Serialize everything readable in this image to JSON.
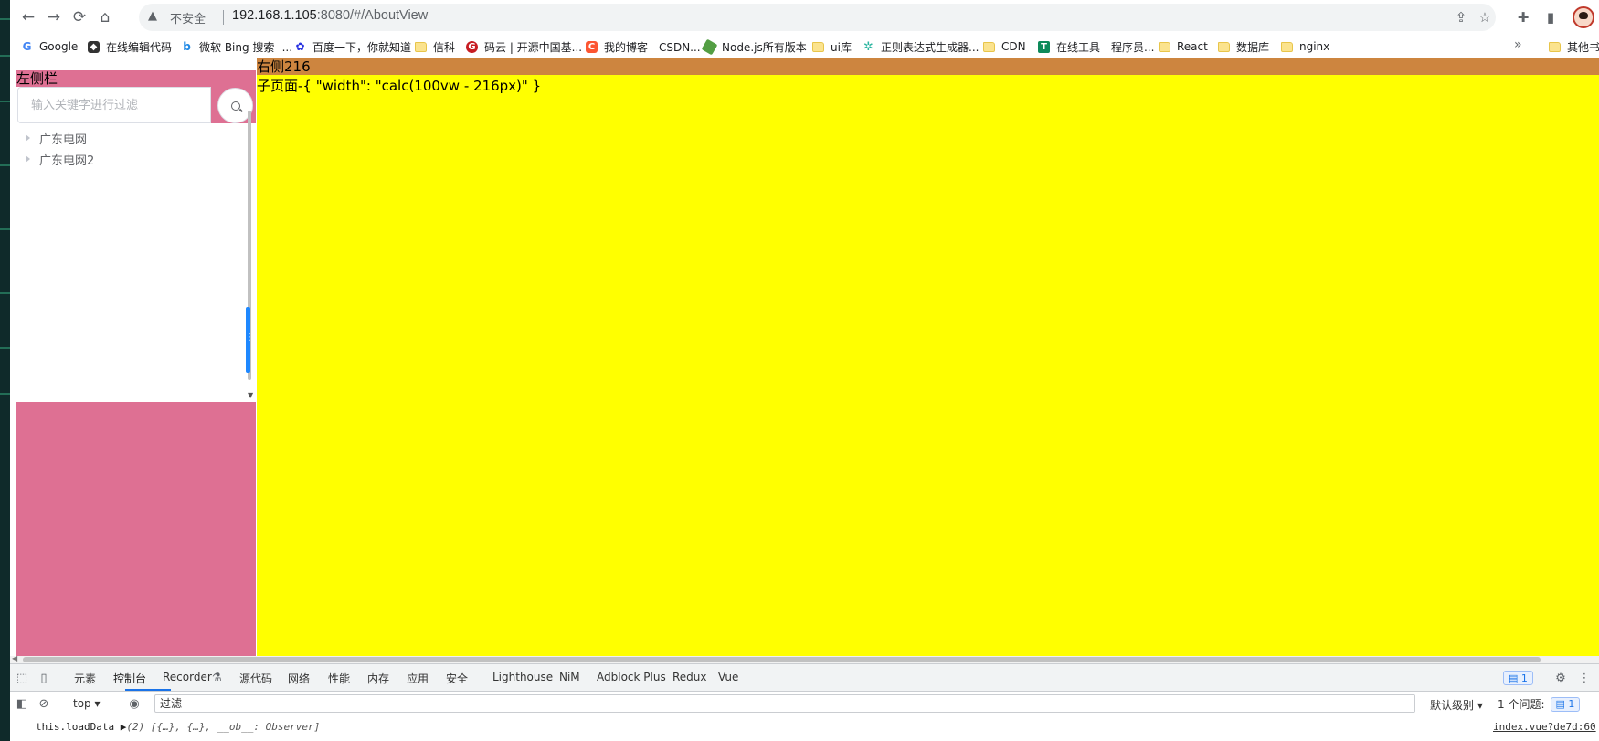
{
  "browser": {
    "address": {
      "security_label": "不安全",
      "url_host": "192.168.1.105",
      "url_rest": ":8080/#/AboutView"
    },
    "bookmarks": [
      {
        "label": "Google",
        "icon": "google-icon"
      },
      {
        "label": "在线编辑代码",
        "icon": "codepen-icon"
      },
      {
        "label": "微软 Bing 搜索 -...",
        "icon": "bing-icon"
      },
      {
        "label": "百度一下，你就知道",
        "icon": "baidu-icon"
      },
      {
        "label": "信科",
        "icon": "folder-icon"
      },
      {
        "label": "码云 | 开源中国基...",
        "icon": "gitee-icon"
      },
      {
        "label": "我的博客 - CSDN...",
        "icon": "csdn-icon"
      },
      {
        "label": "Node.js所有版本",
        "icon": "nodejs-icon"
      },
      {
        "label": "ui库",
        "icon": "folder-icon"
      },
      {
        "label": "正则表达式生成器...",
        "icon": "regex-icon"
      },
      {
        "label": "CDN",
        "icon": "folder-icon"
      },
      {
        "label": "在线工具 - 程序员...",
        "icon": "tools-icon"
      },
      {
        "label": "React",
        "icon": "folder-icon"
      },
      {
        "label": "数据库",
        "icon": "folder-icon"
      },
      {
        "label": "nginx",
        "icon": "folder-icon"
      }
    ],
    "bookmarks_more": "»",
    "other_bookmarks": "其他书"
  },
  "page": {
    "left_title": "左侧栏",
    "search": {
      "placeholder": "输入关键字进行过滤"
    },
    "tree": [
      {
        "label": "广东电网"
      },
      {
        "label": "广东电网2"
      }
    ],
    "right_header": "右侧216",
    "child_text": "子页面-{ \"width\": \"calc(100vw - 216px)\" }",
    "colors": {
      "left_bg": "#de7093",
      "right_header_bg": "#cd853f",
      "right_content_bg": "#ffff00",
      "splitter": "#1e88ff"
    }
  },
  "devtools": {
    "tabs": [
      "元素",
      "控制台",
      "Recorder",
      "源代码",
      "网络",
      "性能",
      "内存",
      "应用",
      "安全",
      "Lighthouse",
      "NiM",
      "Adblock Plus",
      "Redux",
      "Vue"
    ],
    "active_tab": "控制台",
    "issue_badge_count": "1",
    "context": "top",
    "filter_text": "过滤",
    "level": "默认级别",
    "issues_label": "1 个问题:",
    "issues_count": "1",
    "log_text": "this.loadData",
    "log_obj": "(2) [{…}, {…}, __ob__: Observer]",
    "log_source": "index.vue?de7d:60"
  }
}
